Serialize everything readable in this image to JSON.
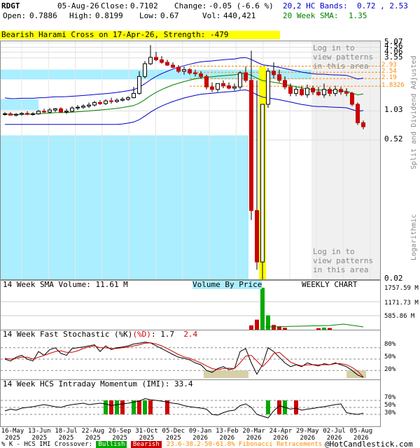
{
  "header": {
    "symbol": "RDGT",
    "date": "05-Aug-26",
    "close_label": "Close:",
    "close": "0.7102",
    "change_label": "Change:",
    "change": "-0.05 (-6.6 %)",
    "open_label": "Open:",
    "open": "0.7886",
    "high_label": "High:",
    "high": "0.8199",
    "low_label": "Low:",
    "low": "0.67",
    "vol_label": "Vol:",
    "vol": "440,421",
    "hc_bands_label": "20,2 HC Bands:",
    "hc_bands_value": "0.72 , 2.53",
    "sma20_label": "20 Week SMA:",
    "sma20_value": "1.35"
  },
  "pattern_banner": "Bearish Harami Cross on 17-Apr-26, Strength: -479",
  "login_notice_top": "Log in to\nview patterns\nin this area",
  "login_notice_bottom": "Log in to\nview patterns\nin this area",
  "side_labels": {
    "split": "Split and Dividend Adjusted",
    "log": "Logarithmic"
  },
  "price_axis": {
    "ticks": [
      "5.07",
      "4.56",
      "4.06",
      "3.55",
      "1.03",
      "0.52",
      "0.02"
    ]
  },
  "fib_labels": [
    "2.93",
    "2.54",
    "2.19",
    "1.8326"
  ],
  "volume_panel": {
    "title": "14 Week SMA Volume: 11.61 M",
    "vbp_label": "Volume By Price",
    "chart_label": "WEEKLY CHART",
    "ticks": [
      "1757.59 M",
      "1171.73 M",
      "585.86 M"
    ]
  },
  "stoch_panel": {
    "title": "14 Week Fast Stochastic (%K)",
    "d_label": "(%D)",
    "k_value": "1.7",
    "d_value": "2.4",
    "ticks": [
      "80%",
      "50%",
      "20%"
    ]
  },
  "imi_panel": {
    "title": "14 Week HCS Intraday Momentum (IMI):",
    "value": "33.4",
    "ticks": [
      "70%",
      "50%",
      "30%"
    ]
  },
  "x_axis": {
    "labels": [
      {
        "d": "16-May",
        "y": "2025"
      },
      {
        "d": "13-Jun",
        "y": "2025"
      },
      {
        "d": "18-Jul",
        "y": "2025"
      },
      {
        "d": "22-Aug",
        "y": "2025"
      },
      {
        "d": "26-Sep",
        "y": "2025"
      },
      {
        "d": "31-Oct",
        "y": "2025"
      },
      {
        "d": "05-Dec",
        "y": "2025"
      },
      {
        "d": "09-Jan",
        "y": "2026"
      },
      {
        "d": "13-Feb",
        "y": "2026"
      },
      {
        "d": "20-Mar",
        "y": "2026"
      },
      {
        "d": "24-Apr",
        "y": "2026"
      },
      {
        "d": "29-May",
        "y": "2026"
      },
      {
        "d": "02-Jul",
        "y": "2026"
      },
      {
        "d": "05-Aug",
        "y": "2026"
      }
    ]
  },
  "footer": {
    "prefix": "% K - HCS IMI Crossover:",
    "bullish": "Bullish",
    "bearish": "Bearish",
    "fib": "23.6-38.2-50-61.8% Fibonacci Retracements",
    "copyright": "@HotCandlestick.com"
  },
  "colors": {
    "up": "#00aa00",
    "down": "#cc0000",
    "band": "#0000cc",
    "sma": "#008000",
    "vbp": "#aaeeff",
    "highlight": "#ffff00",
    "fib": "#ff8800"
  },
  "chart_data": [
    {
      "type": "candlestick",
      "title": "",
      "y_scale": "log",
      "ylim": [
        0.02,
        5.07
      ],
      "x": [
        "2025-05-16",
        "2025-05-23",
        "2025-05-30",
        "2025-06-06",
        "2025-06-13",
        "2025-06-20",
        "2025-06-27",
        "2025-07-04",
        "2025-07-11",
        "2025-07-18",
        "2025-07-25",
        "2025-08-01",
        "2025-08-08",
        "2025-08-15",
        "2025-08-22",
        "2025-08-29",
        "2025-09-05",
        "2025-09-12",
        "2025-09-19",
        "2025-09-26",
        "2025-10-03",
        "2025-10-10",
        "2025-10-17",
        "2025-10-24",
        "2025-10-31",
        "2025-11-07",
        "2025-11-14",
        "2025-11-21",
        "2025-11-28",
        "2025-12-05",
        "2025-12-12",
        "2025-12-19",
        "2025-12-26",
        "2026-01-02",
        "2026-01-09",
        "2026-01-16",
        "2026-01-23",
        "2026-01-30",
        "2026-02-06",
        "2026-02-13",
        "2026-02-20",
        "2026-02-27",
        "2026-03-06",
        "2026-03-13",
        "2026-03-20",
        "2026-03-27",
        "2026-04-03",
        "2026-04-10",
        "2026-04-17",
        "2026-04-24",
        "2026-05-01",
        "2026-05-08",
        "2026-05-15",
        "2026-05-22",
        "2026-05-29",
        "2026-06-05",
        "2026-06-12",
        "2026-06-19",
        "2026-06-26",
        "2026-07-02",
        "2026-07-10",
        "2026-07-17",
        "2026-07-24",
        "2026-07-31",
        "2026-08-05"
      ],
      "open": [
        0.95,
        0.96,
        0.93,
        0.95,
        0.97,
        0.95,
        0.96,
        1.02,
        1.0,
        1.05,
        1.08,
        1.0,
        1.02,
        1.1,
        1.12,
        1.15,
        1.18,
        1.25,
        1.22,
        1.3,
        1.28,
        1.32,
        1.35,
        1.4,
        1.55,
        2.3,
        3.1,
        3.6,
        3.4,
        3.2,
        3.0,
        2.85,
        2.6,
        2.7,
        2.5,
        2.45,
        2.3,
        1.8,
        1.7,
        1.95,
        1.85,
        1.75,
        1.8,
        2.5,
        2.1,
        0.1,
        0.03,
        1.2,
        2.6,
        2.4,
        2.1,
        1.8,
        1.55,
        1.7,
        1.5,
        1.75,
        1.6,
        1.5,
        1.7,
        1.55,
        1.7,
        1.6,
        1.55,
        1.2,
        0.78
      ],
      "high": [
        1.0,
        1.0,
        0.98,
        1.0,
        1.02,
        1.0,
        1.05,
        1.08,
        1.1,
        1.1,
        1.12,
        1.08,
        1.15,
        1.18,
        1.2,
        1.25,
        1.3,
        1.32,
        1.35,
        1.4,
        1.38,
        1.42,
        1.45,
        1.8,
        2.6,
        3.3,
        4.8,
        4.1,
        3.7,
        3.4,
        3.2,
        3.0,
        2.9,
        2.8,
        2.7,
        2.6,
        2.4,
        2.0,
        1.95,
        2.1,
        2.0,
        1.95,
        2.6,
        2.9,
        4.2,
        2.1,
        0.2,
        2.8,
        3.2,
        2.7,
        2.3,
        1.95,
        1.8,
        1.85,
        1.9,
        1.85,
        1.8,
        1.95,
        1.8,
        1.85,
        1.8,
        1.75,
        1.6,
        1.25,
        0.82
      ],
      "low": [
        0.92,
        0.92,
        0.9,
        0.92,
        0.93,
        0.92,
        0.94,
        0.98,
        0.97,
        1.0,
        1.0,
        0.96,
        1.0,
        1.05,
        1.08,
        1.1,
        1.14,
        1.18,
        1.18,
        1.22,
        1.24,
        1.28,
        1.3,
        1.38,
        1.5,
        2.2,
        3.0,
        3.3,
        3.1,
        2.95,
        2.8,
        2.5,
        2.4,
        2.4,
        2.3,
        2.2,
        1.7,
        1.6,
        1.6,
        1.75,
        1.7,
        1.65,
        1.7,
        2.0,
        0.08,
        0.025,
        0.02,
        1.1,
        2.2,
        2.0,
        1.7,
        1.45,
        1.45,
        1.45,
        1.4,
        1.5,
        1.45,
        1.4,
        1.45,
        1.45,
        1.5,
        1.45,
        1.15,
        0.74,
        0.67
      ],
      "close": [
        0.96,
        0.93,
        0.95,
        0.97,
        0.95,
        0.96,
        1.02,
        1.0,
        1.05,
        1.08,
        1.0,
        1.02,
        1.1,
        1.12,
        1.15,
        1.18,
        1.25,
        1.22,
        1.3,
        1.28,
        1.32,
        1.35,
        1.4,
        1.55,
        2.3,
        3.1,
        3.6,
        3.4,
        3.2,
        3.0,
        2.85,
        2.6,
        2.7,
        2.5,
        2.45,
        2.3,
        1.8,
        1.7,
        1.95,
        1.85,
        1.75,
        1.8,
        2.5,
        2.1,
        0.1,
        0.03,
        1.2,
        2.6,
        2.4,
        2.1,
        1.8,
        1.55,
        1.7,
        1.5,
        1.75,
        1.6,
        1.5,
        1.7,
        1.55,
        1.7,
        1.6,
        1.55,
        1.2,
        0.78,
        0.7102
      ]
    },
    {
      "type": "bar",
      "title": "",
      "note": "volume, in millions; mostly small except March-April 2026 spike",
      "x_index_values": [
        [
          44,
          180
        ],
        [
          45,
          420
        ],
        [
          46,
          1757.59
        ],
        [
          47,
          600
        ],
        [
          48,
          200
        ],
        [
          49,
          120
        ],
        [
          50,
          80
        ],
        [
          56,
          60
        ],
        [
          57,
          90
        ],
        [
          58,
          70
        ]
      ]
    },
    {
      "type": "line",
      "ylim": [
        0,
        100
      ],
      "series": [
        {
          "name": "%K",
          "values": [
            50,
            45,
            55,
            60,
            50,
            45,
            70,
            60,
            75,
            80,
            65,
            60,
            78,
            80,
            82,
            85,
            88,
            70,
            85,
            75,
            80,
            82,
            85,
            90,
            92,
            95,
            93,
            85,
            78,
            70,
            62,
            55,
            52,
            48,
            40,
            35,
            20,
            15,
            25,
            30,
            22,
            25,
            70,
            78,
            40,
            10,
            35,
            80,
            70,
            55,
            40,
            30,
            35,
            30,
            40,
            35,
            32,
            38,
            35,
            40,
            35,
            30,
            20,
            8,
            1.7
          ]
        },
        {
          "name": "%D",
          "values": [
            52,
            50,
            52,
            55,
            55,
            50,
            55,
            60,
            65,
            70,
            72,
            68,
            68,
            72,
            78,
            82,
            85,
            80,
            80,
            78,
            78,
            80,
            82,
            85,
            88,
            92,
            93,
            90,
            85,
            78,
            70,
            62,
            56,
            52,
            46,
            40,
            32,
            25,
            22,
            25,
            26,
            25,
            40,
            58,
            60,
            45,
            30,
            45,
            65,
            68,
            55,
            42,
            36,
            32,
            35,
            35,
            35,
            35,
            35,
            38,
            38,
            35,
            28,
            18,
            2.4
          ]
        }
      ]
    },
    {
      "type": "line",
      "ylim": [
        0,
        100
      ],
      "series": [
        {
          "name": "IMI",
          "values": [
            40,
            45,
            42,
            48,
            50,
            52,
            55,
            58,
            55,
            52,
            50,
            55,
            58,
            60,
            62,
            58,
            60,
            62,
            60,
            55,
            58,
            60,
            62,
            65,
            68,
            75,
            72,
            70,
            68,
            65,
            62,
            60,
            55,
            52,
            50,
            48,
            45,
            30,
            28,
            35,
            40,
            42,
            55,
            60,
            50,
            30,
            25,
            20,
            40,
            55,
            50,
            45,
            48,
            42,
            45,
            47,
            50,
            52,
            55,
            58,
            60,
            35,
            32,
            30,
            33.4
          ]
        }
      ]
    }
  ]
}
